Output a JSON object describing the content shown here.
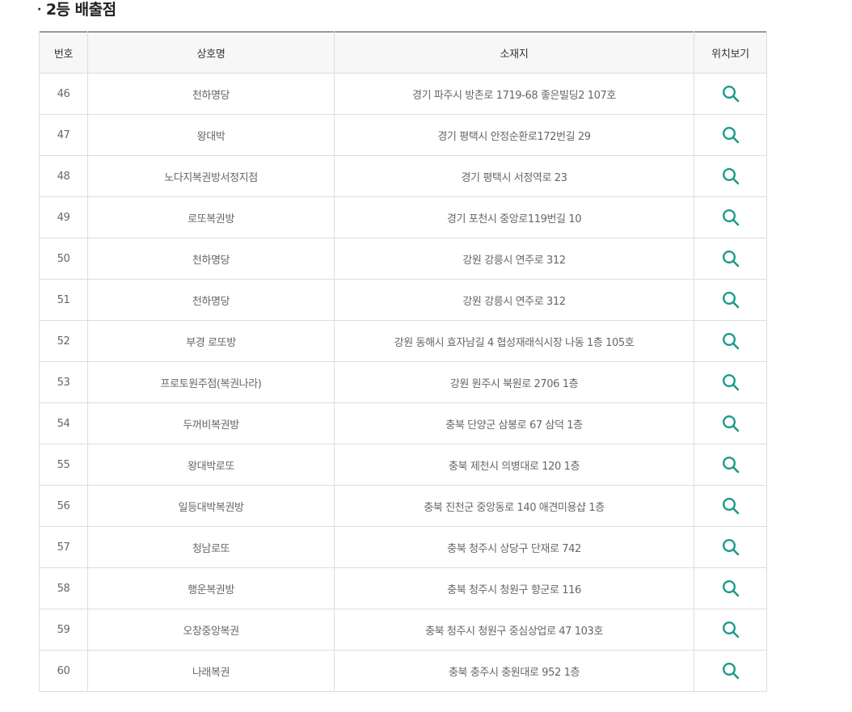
{
  "section": {
    "bullet": "·",
    "title": "2등 배출점"
  },
  "table": {
    "headers": {
      "number": "번호",
      "shop_name": "상호명",
      "address": "소재지",
      "location": "위치보기"
    },
    "rows": [
      {
        "number": "46",
        "shop_name": "천하명당",
        "address": "경기 파주시 방촌로 1719-68 좋은빌딩2 107호"
      },
      {
        "number": "47",
        "shop_name": "왕대박",
        "address": "경기 평택시 안정순환로172번길 29"
      },
      {
        "number": "48",
        "shop_name": "노다지복권방서정지점",
        "address": "경기 평택시 서정역로 23"
      },
      {
        "number": "49",
        "shop_name": "로또복권방",
        "address": "경기 포천시 중앙로119번길 10"
      },
      {
        "number": "50",
        "shop_name": "천하명당",
        "address": "강원 강릉시 연주로 312"
      },
      {
        "number": "51",
        "shop_name": "천하명당",
        "address": "강원 강릉시 연주로 312"
      },
      {
        "number": "52",
        "shop_name": "부경 로또방",
        "address": "강원 동해시 효자남길 4 협성재래식시장 나동 1층 105호"
      },
      {
        "number": "53",
        "shop_name": "프로토원주점(복권나라)",
        "address": "강원 원주시 북원로 2706 1층"
      },
      {
        "number": "54",
        "shop_name": "두꺼비복권방",
        "address": "충북 단양군 삼봉로 67 삼덕 1층"
      },
      {
        "number": "55",
        "shop_name": "왕대박로또",
        "address": "충북 제천시 의병대로 120 1층"
      },
      {
        "number": "56",
        "shop_name": "일등대박복권방",
        "address": "충북 진천군 중앙동로 140 애견미용샵 1층"
      },
      {
        "number": "57",
        "shop_name": "청남로또",
        "address": "충북 청주시 상당구 단재로 742"
      },
      {
        "number": "58",
        "shop_name": "행운복권방",
        "address": "충북 청주시 청원구 향군로 116"
      },
      {
        "number": "59",
        "shop_name": "오창중앙복권",
        "address": "충북 청주시 청원구 중심상업로 47 103호"
      },
      {
        "number": "60",
        "shop_name": "나래복권",
        "address": "충북 충주시 충원대로 952 1층"
      }
    ]
  },
  "icons": {
    "location_icon": "search-icon"
  },
  "colors": {
    "accent": "#1a9a8c",
    "header_bg": "#f7f7f7",
    "top_border": "#444444",
    "cell_border": "#dddddd",
    "text": "#666666"
  }
}
